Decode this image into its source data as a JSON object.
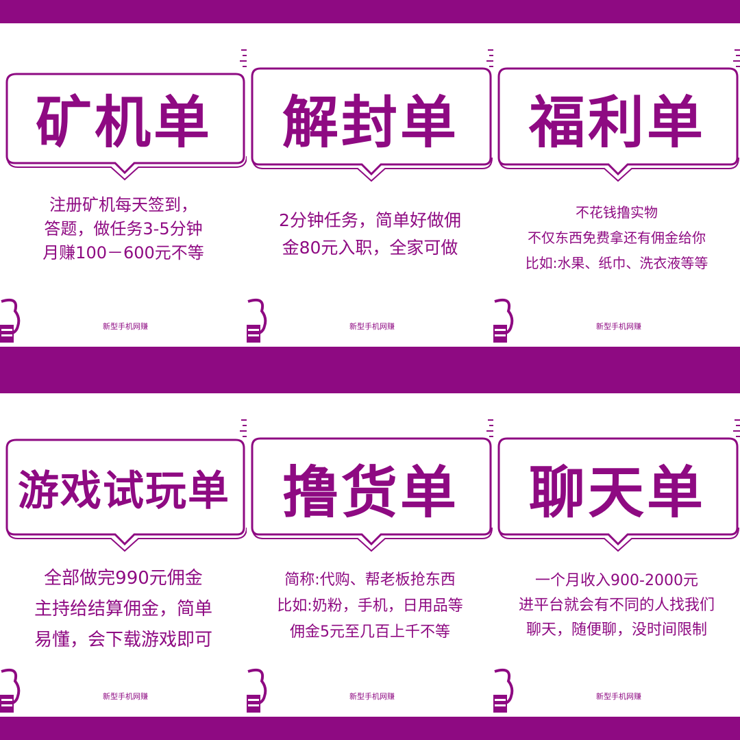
{
  "brand_color": "#8e0a82",
  "cards": [
    {
      "title": "矿机单",
      "desc": [
        "注册矿机每天签到，",
        "答题，做任务3-5分钟",
        "月赚100－600元不等"
      ],
      "brand": "新型手机网赚"
    },
    {
      "title": "解封单",
      "desc": [
        "2分钟任务，简单好做佣",
        "金80元入职，全家可做"
      ],
      "brand": "新型手机网赚"
    },
    {
      "title": "福利单",
      "desc": [
        "不花钱撸实物",
        "不仅东西免费拿还有佣金给你",
        "比如:水果、纸巾、洗衣液等等"
      ],
      "brand": "新型手机网赚"
    },
    {
      "title": "游戏试玩单",
      "desc": [
        "全部做完990元佣金",
        "主持给结算佣金，简单",
        "易懂，会下载游戏即可"
      ],
      "brand": "新型手机网赚"
    },
    {
      "title": "撸货单",
      "desc": [
        "简称:代购、帮老板抢东西",
        "比如:奶粉，手机，日用品等",
        "佣金5元至几百上千不等"
      ],
      "brand": "新型手机网赚"
    },
    {
      "title": "聊天单",
      "desc": [
        "一个月收入900-2000元",
        "进平台就会有不同的人找我们",
        "聊天，随便聊，没时间限制"
      ],
      "brand": "新型手机网赚"
    }
  ]
}
